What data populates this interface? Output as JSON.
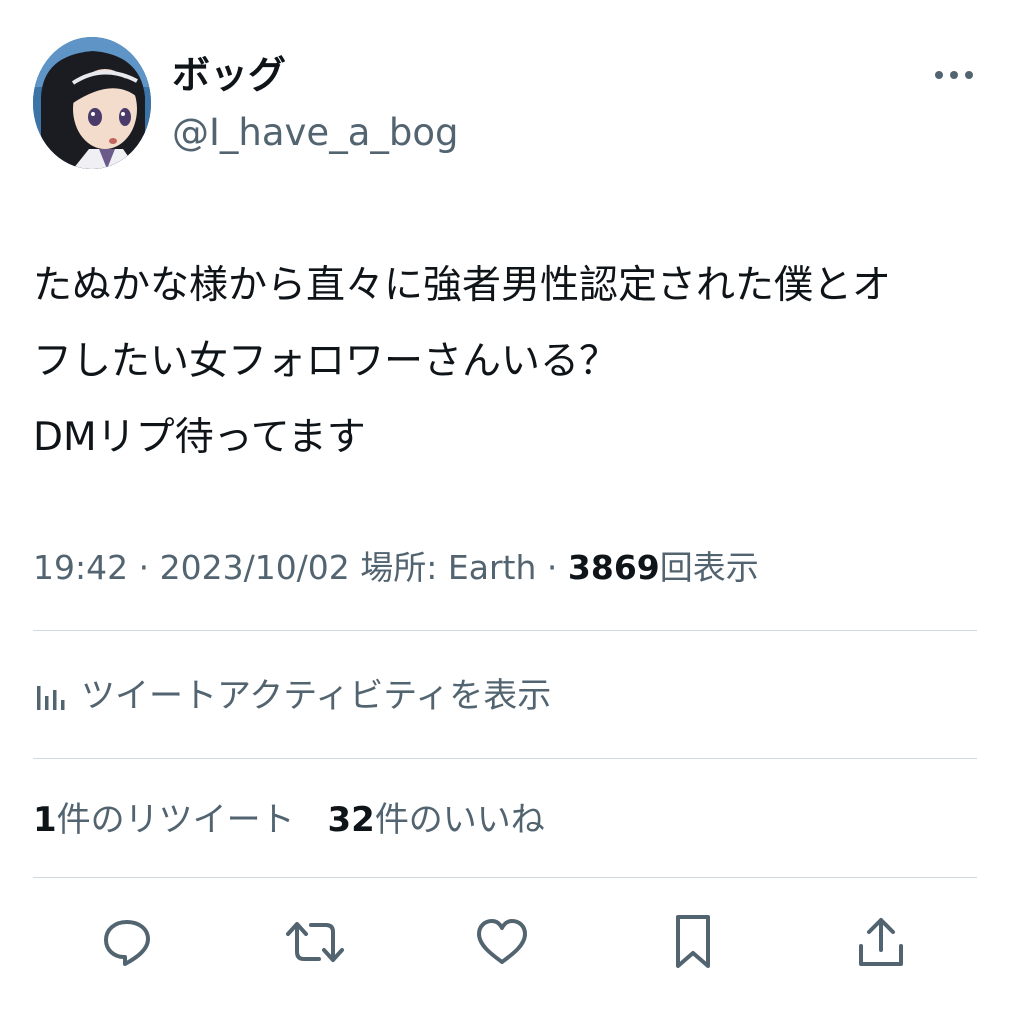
{
  "user": {
    "display_name": "ボッグ",
    "handle": "@I_have_a_bog"
  },
  "tweet": {
    "lines": [
      "たぬかな様から直々に強者男性認定された僕とオ",
      "フしたい女フォロワーさんいる？",
      "DMリプ待ってます"
    ]
  },
  "meta": {
    "time": "19:42",
    "sep1": " · ",
    "date": "2023/10/02",
    "location_label": "場所: ",
    "location": "Earth",
    "sep2": " · ",
    "views": "3869",
    "views_label": "回表示"
  },
  "activity": {
    "label": "ツイートアクティビティを表示"
  },
  "stats": {
    "retweets": "1",
    "retweets_label": "件のリツイート",
    "likes": "32",
    "likes_label": "件のいいね"
  },
  "icons": {
    "more": "more-dots-icon",
    "activity": "bar-chart-icon",
    "reply": "reply-icon",
    "retweet": "retweet-icon",
    "like": "heart-icon",
    "bookmark": "bookmark-icon",
    "share": "share-icon"
  },
  "colors": {
    "text": "#0f1419",
    "secondary": "#536471",
    "divider": "#cfd9de",
    "avatar_bg": "#2a5a8a"
  }
}
